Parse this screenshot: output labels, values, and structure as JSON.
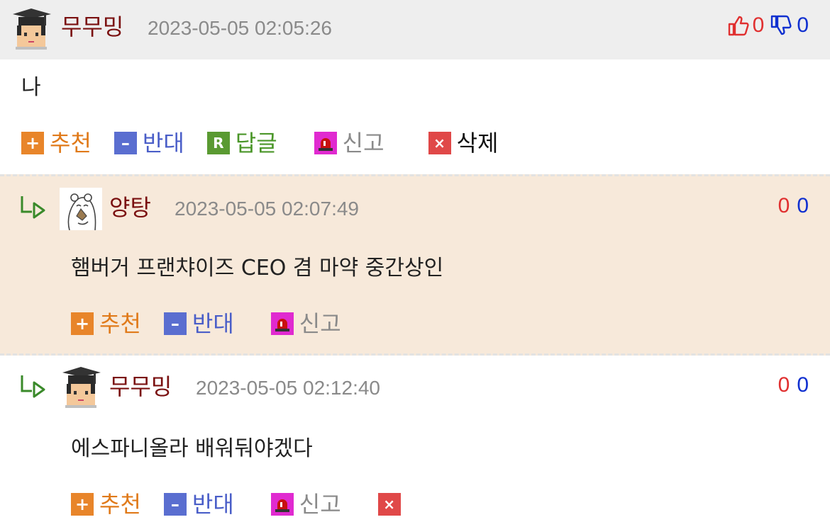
{
  "comments": [
    {
      "nickname": "무무밍",
      "datetime": "2023-05-05 02:05:26",
      "text": "나",
      "votes_up": "0",
      "votes_down": "0",
      "actions": {
        "recommend": "추천",
        "oppose": "반대",
        "reply": "답글",
        "report": "신고",
        "delete": "삭제"
      }
    },
    {
      "nickname": "양탕",
      "datetime": "2023-05-05 02:07:49",
      "text": "햄버거 프랜챠이즈 CEO 겸 마약 중간상인",
      "votes_up": "0",
      "votes_down": "0",
      "actions": {
        "recommend": "추천",
        "oppose": "반대",
        "report": "신고"
      }
    },
    {
      "nickname": "무무밍",
      "datetime": "2023-05-05 02:12:40",
      "text": "에스파니올라 배워둬야겠다",
      "votes_up": "0",
      "votes_down": "0",
      "actions": {
        "recommend": "추천",
        "oppose": "반대",
        "report": "신고"
      }
    }
  ],
  "icons": {
    "thumbs_up": "thumbs-up-icon",
    "thumbs_down": "thumbs-down-icon",
    "reply_arrow": "reply-arrow-icon",
    "recommend": "plus-icon",
    "oppose": "minus-icon",
    "reply": "reply-icon",
    "report": "siren-icon",
    "delete": "x-icon"
  },
  "icon_glyphs": {
    "plus": "+",
    "minus": "–",
    "reply": "R",
    "delete": "×"
  },
  "colors": {
    "nickname": "#7a1010",
    "vote_up": "#e03030",
    "vote_down": "#1030d0",
    "reply_bg": "#f7e9da",
    "header_bg": "#eeeeee"
  }
}
